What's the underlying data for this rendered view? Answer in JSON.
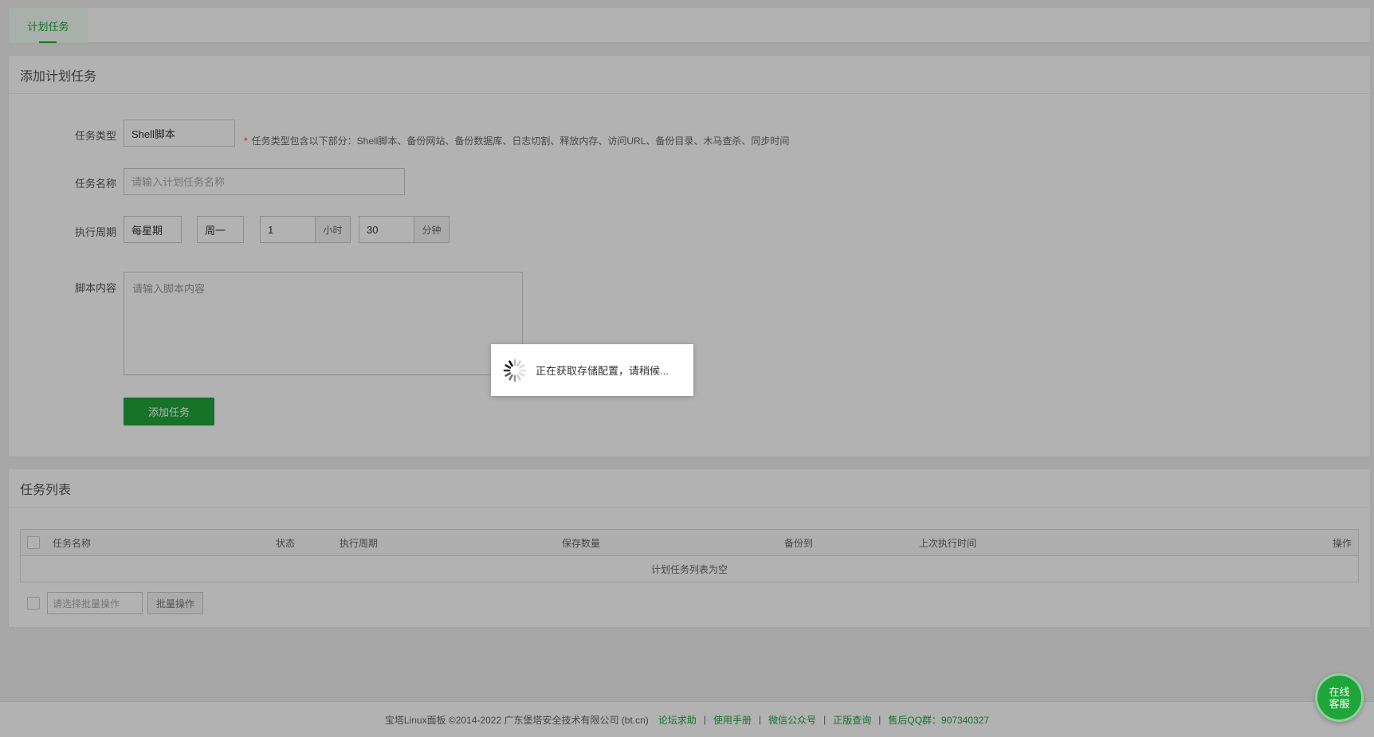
{
  "tabs": [
    {
      "label": "计划任务",
      "active": true
    }
  ],
  "add_panel": {
    "title": "添加计划任务",
    "task_type": {
      "label": "任务类型",
      "value": "Shell脚本",
      "hint_star": "*",
      "hint": "任务类型包含以下部分：Shell脚本、备份网站、备份数据库、日志切割、释放内存、访问URL、备份目录、木马查杀、同步时间"
    },
    "task_name": {
      "label": "任务名称",
      "placeholder": "请输入计划任务名称",
      "value": ""
    },
    "period": {
      "label": "执行周期",
      "cycle": "每星期",
      "weekday": "周一",
      "hour": "1",
      "hour_unit": "小时",
      "minute": "30",
      "minute_unit": "分钟"
    },
    "script": {
      "label": "脚本内容",
      "placeholder": "请输入脚本内容",
      "value": ""
    },
    "submit_label": "添加任务"
  },
  "list_panel": {
    "title": "任务列表",
    "columns": [
      "任务名称",
      "状态",
      "执行周期",
      "保存数量",
      "备份到",
      "上次执行时间",
      "操作"
    ],
    "empty_text": "计划任务列表为空",
    "batch_placeholder": "请选择批量操作",
    "batch_button": "批量操作"
  },
  "footer": {
    "copyright": "宝塔Linux面板 ©2014-2022 广东堡塔安全技术有限公司 (bt.cn)",
    "separator": "|",
    "links": [
      "论坛求助",
      "使用手册",
      "微信公众号",
      "正版查询",
      "售后QQ群：907340327"
    ]
  },
  "loading": {
    "text": "正在获取存储配置，请稍候..."
  },
  "chat": {
    "line1": "在线",
    "line2": "客服"
  },
  "colors": {
    "accent": "#20a53a",
    "required": "#ff3333",
    "overlay": "rgba(0,0,0,0.3)"
  },
  "icons": {
    "loading": "spinner-icon"
  }
}
